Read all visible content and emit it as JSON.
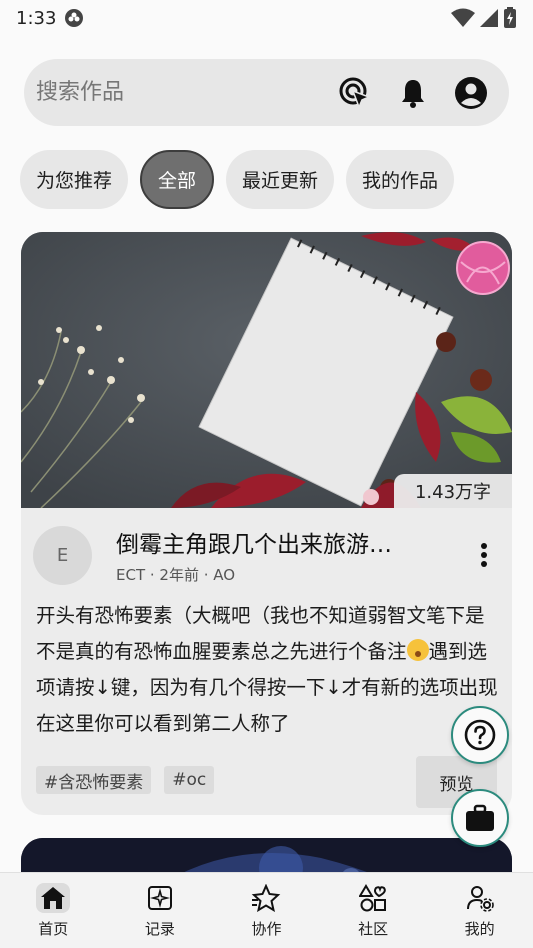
{
  "status": {
    "time": "1:33"
  },
  "search": {
    "placeholder": "搜索作品"
  },
  "chips": [
    {
      "label": "为您推荐"
    },
    {
      "label": "全部",
      "active": true
    },
    {
      "label": "最近更新"
    },
    {
      "label": "我的作品"
    }
  ],
  "card": {
    "word_count": "1.43万字",
    "avatar_letter": "E",
    "title": "倒霉主角跟几个出来旅游…",
    "meta": "ECT · 2年前 · AO",
    "body_before_emoji": "开头有恐怖要素（大概吧（我也不知道弱智文笔下是不是真的有恐怖血腥要素总之先进行个备注",
    "body_after_emoji": "遇到选项请按↓键，因为有几个得按一下↓才有新的选项出现在这里你可以看到第二人称了",
    "tags": [
      "#含恐怖要素",
      "#oc"
    ],
    "preview_label": "预览"
  },
  "nav": [
    {
      "label": "首页",
      "icon": "home-icon",
      "active": true
    },
    {
      "label": "记录",
      "icon": "record-icon"
    },
    {
      "label": "协作",
      "icon": "collab-icon"
    },
    {
      "label": "社区",
      "icon": "community-icon"
    },
    {
      "label": "我的",
      "icon": "profile-icon"
    }
  ],
  "colors": {
    "accent": "#2c8b7e",
    "chip_active": "#6f6f6f"
  }
}
